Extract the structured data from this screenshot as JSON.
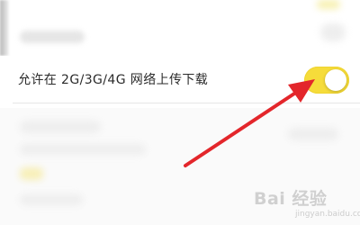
{
  "setting": {
    "label": "允许在 2G/3G/4G 网络上传下载",
    "toggle_on": true
  },
  "colors": {
    "toggle_on": "#f6dc3a",
    "arrow": "#e3262b"
  },
  "watermark": {
    "main": "Bai  经验",
    "sub": "jingyan.baidu.com"
  }
}
